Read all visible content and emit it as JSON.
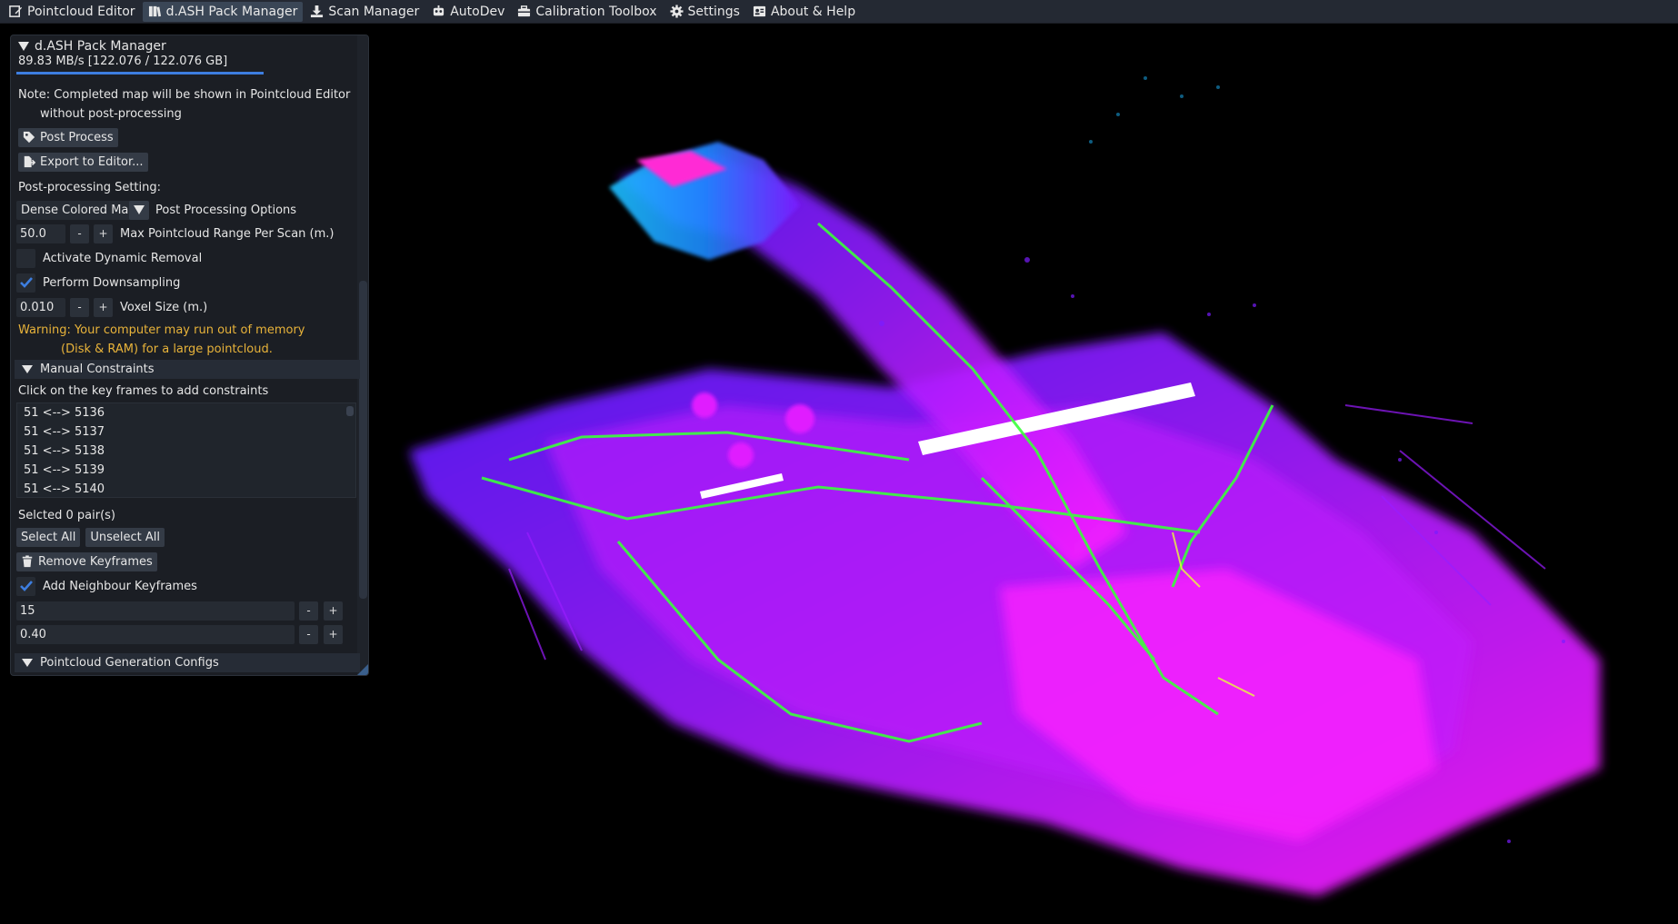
{
  "menu": [
    {
      "label": "Pointcloud Editor",
      "icon": "edit-icon",
      "active": false
    },
    {
      "label": "d.ASH Pack Manager",
      "icon": "books-icon",
      "active": true
    },
    {
      "label": "Scan Manager",
      "icon": "download-icon",
      "active": false
    },
    {
      "label": "AutoDev",
      "icon": "robot-icon",
      "active": false
    },
    {
      "label": "Calibration Toolbox",
      "icon": "toolbox-icon",
      "active": false
    },
    {
      "label": "Settings",
      "icon": "gear-icon",
      "active": false
    },
    {
      "label": "About & Help",
      "icon": "id-card-icon",
      "active": false
    }
  ],
  "panel": {
    "title": "d.ASH Pack Manager",
    "progress_text": "89.83 MB/s [122.076 / 122.076 GB]",
    "progress_fraction": 1.0,
    "note_line1": "Note: Completed map will be shown in Pointcloud Editor",
    "note_line2": "without post-processing",
    "post_process_label": "Post Process",
    "export_label": "Export to Editor...",
    "pp_setting_label": "Post-processing Setting:",
    "pp_mode_value": "Dense Colored Map",
    "pp_options_label": "Post Processing Options",
    "max_range_value": "50.0",
    "max_range_label": "Max Pointcloud Range Per Scan (m.)",
    "dynamic_removal_label": "Activate Dynamic Removal",
    "dynamic_removal_checked": false,
    "downsampling_label": "Perform Downsampling",
    "downsampling_checked": true,
    "voxel_value": "0.010",
    "voxel_label": "Voxel Size (m.)",
    "warn_line1": "Warning: Your computer may run out of memory",
    "warn_line2": "(Disk & RAM) for a large pointcloud.",
    "manual_constraints_title": "Manual Constraints",
    "constraints_hint": "Click on the key frames to add constraints",
    "constraints": [
      "51 <--> 5136",
      "51 <--> 5137",
      "51 <--> 5138",
      "51 <--> 5139",
      "51 <--> 5140"
    ],
    "selected_text": "Selcted 0 pair(s)",
    "select_all_label": "Select All",
    "unselect_all_label": "Unselect All",
    "remove_keyframes_label": "Remove Keyframes",
    "add_neighbour_label": "Add Neighbour Keyframes",
    "add_neighbour_checked": true,
    "neighbour_count_value": "15",
    "neighbour_dist_value": "0.40",
    "minus_label": "-",
    "plus_label": "+",
    "pcgen_title": "Pointcloud Generation Configs"
  },
  "colors": {
    "accent": "#3d7ee0",
    "warning": "#e8b33a",
    "panel_bg": "#1b1e24",
    "menubar_bg": "#242933",
    "cloud_violet": "#7a1cff",
    "cloud_magenta": "#ff1cff",
    "cloud_blue": "#1c8bff",
    "cloud_green": "#3aff3a"
  }
}
